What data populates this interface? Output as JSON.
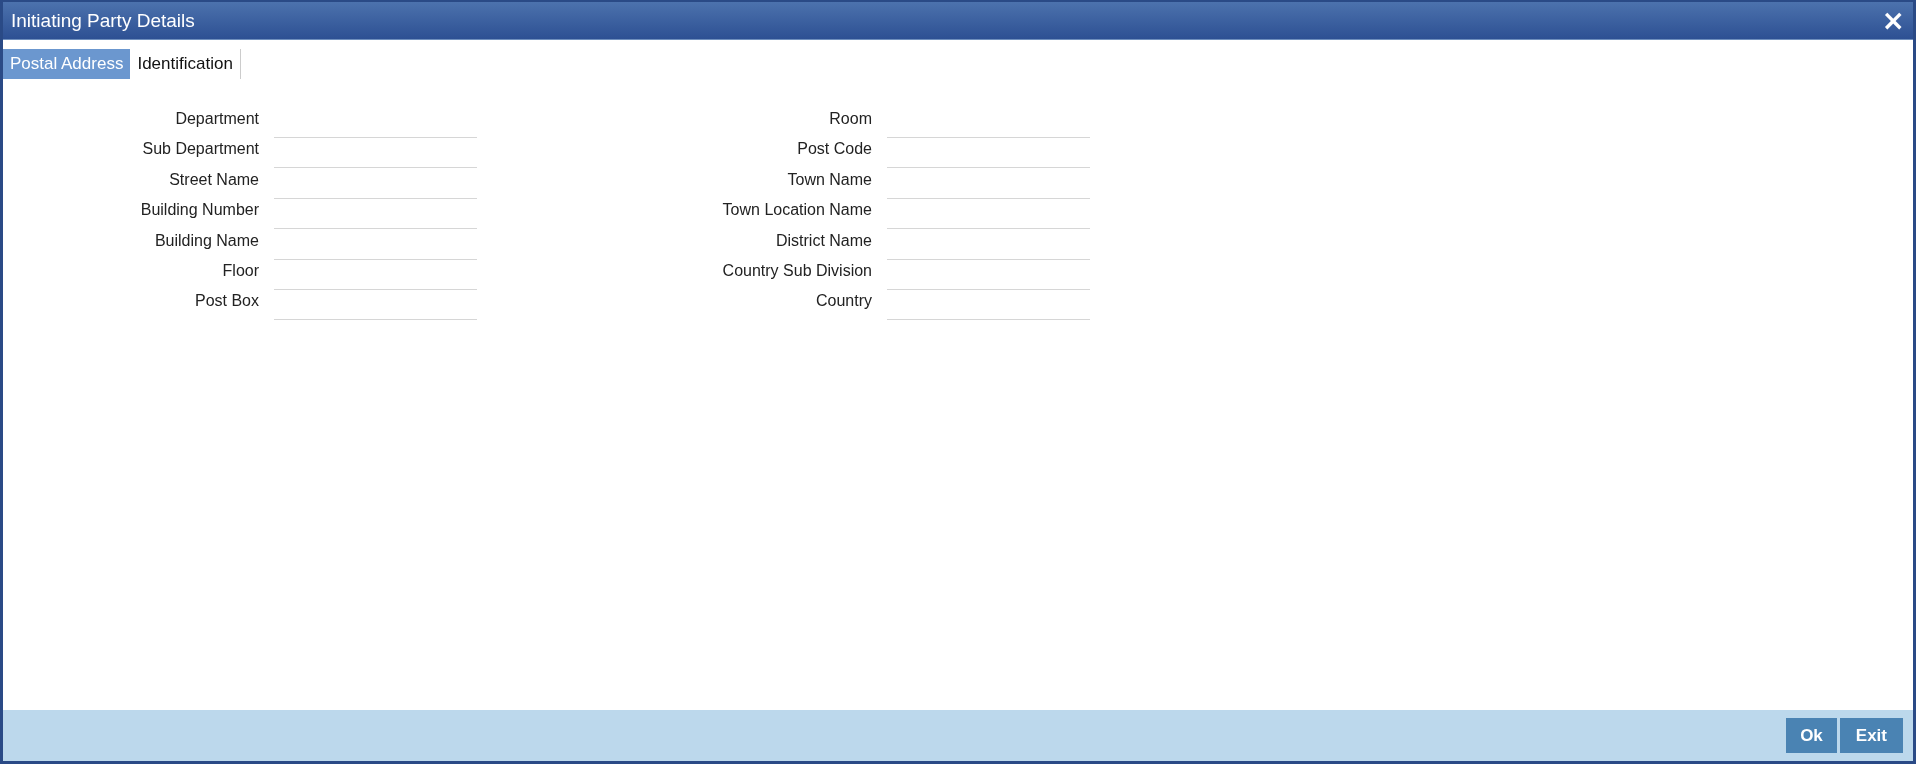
{
  "window": {
    "title": "Initiating Party Details",
    "close": "×"
  },
  "tabs": [
    {
      "label": "Postal Address",
      "selected": true
    },
    {
      "label": "Identification",
      "selected": false
    }
  ],
  "left_fields": [
    {
      "label": "Department"
    },
    {
      "label": "Sub Department"
    },
    {
      "label": "Street Name"
    },
    {
      "label": "Building Number"
    },
    {
      "label": "Building Name"
    },
    {
      "label": "Floor"
    },
    {
      "label": "Post Box"
    }
  ],
  "right_fields": [
    {
      "label": "Room"
    },
    {
      "label": "Post Code"
    },
    {
      "label": "Town Name"
    },
    {
      "label": "Town Location Name"
    },
    {
      "label": "District Name"
    },
    {
      "label": "Country Sub Division"
    },
    {
      "label": "Country"
    }
  ],
  "buttons": [
    "Ok",
    "Exit"
  ]
}
